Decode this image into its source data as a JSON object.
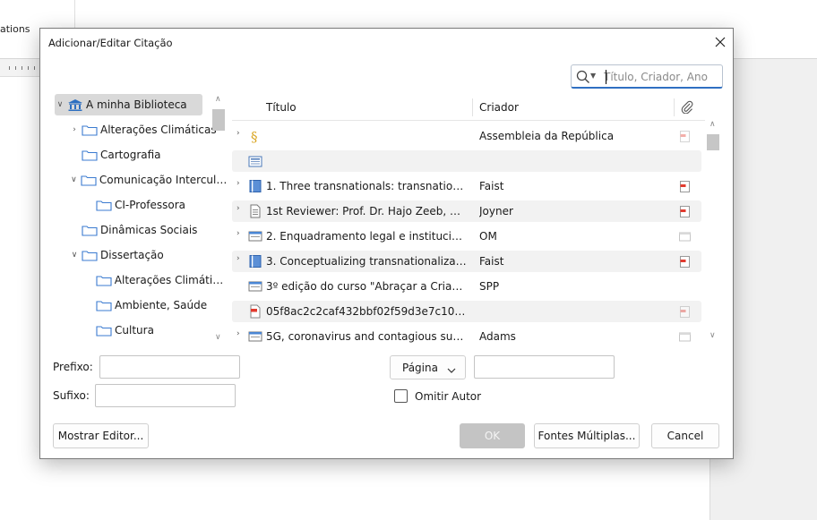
{
  "background": {
    "ribbon_text": "ations"
  },
  "dialog": {
    "title": "Adicionar/Editar Citação",
    "search": {
      "placeholder": "Título, Criador, Ano",
      "value": ""
    },
    "library": [
      {
        "label": "A minha Biblioteca",
        "icon": "library-icon",
        "twisty": "expanded",
        "selected": true
      },
      {
        "label": "Alterações Climáticas",
        "icon": "folder-icon",
        "twisty": "collapsed"
      },
      {
        "label": "Cartografia",
        "icon": "folder-icon",
        "twisty": "none"
      },
      {
        "label": "Comunicação Intercultural",
        "icon": "folder-icon",
        "twisty": "expanded"
      },
      {
        "label": "CI-Professora",
        "icon": "folder-icon",
        "twisty": "none"
      },
      {
        "label": "Dinâmicas Sociais",
        "icon": "folder-icon",
        "twisty": "none"
      },
      {
        "label": "Dissertação",
        "icon": "folder-icon",
        "twisty": "expanded"
      },
      {
        "label": "Alterações Climáticas",
        "icon": "folder-icon",
        "twisty": "none"
      },
      {
        "label": "Ambiente, Saúde",
        "icon": "folder-icon",
        "twisty": "none"
      },
      {
        "label": "Cultura",
        "icon": "folder-icon",
        "twisty": "none"
      }
    ],
    "table": {
      "columns": {
        "title": "Título",
        "creator": "Criador",
        "attachments_icon": "paperclip-icon"
      },
      "rows": [
        {
          "icon": "statute-icon",
          "title": "",
          "creator": "Assembleia da República",
          "twisty": true,
          "attachment": "pdf-faded"
        },
        {
          "icon": "newspaper-icon",
          "title": "",
          "creator": "",
          "twisty": false,
          "attachment": "none"
        },
        {
          "icon": "book-icon",
          "title": "1. Three transnationals: transnationalism and the...",
          "creator": "Faist",
          "twisty": true,
          "attachment": "pdf"
        },
        {
          "icon": "document-icon",
          "title": "1st Reviewer: Prof. Dr. Hajo Zeeb, Universität...",
          "creator": "Joyner",
          "twisty": true,
          "attachment": "pdf"
        },
        {
          "icon": "webpage-icon",
          "title": "2. Enquadramento legal e institucional...",
          "creator": "OM",
          "twisty": true,
          "attachment": "snapshot"
        },
        {
          "icon": "book-icon",
          "title": "3. Conceptualizing transnationalization...",
          "creator": "Faist",
          "twisty": true,
          "attachment": "pdf"
        },
        {
          "icon": "webpage-icon",
          "title": "3º edição do curso \"Abraçar a Criança\"...",
          "creator": "SPP",
          "twisty": false,
          "attachment": "none"
        },
        {
          "icon": "pdf-icon",
          "title": "05f8ac2c2caf432bbf02f59d3e7c10a0...",
          "creator": "",
          "twisty": false,
          "attachment": "pdf-faded"
        },
        {
          "icon": "webpage-icon",
          "title": "5G, coronavirus and contagious superspreading...",
          "creator": "Adams",
          "twisty": true,
          "attachment": "snapshot"
        }
      ]
    },
    "fields": {
      "prefix_label": "Prefixo:",
      "suffix_label": "Sufixo:",
      "prefix_value": "",
      "suffix_value": "",
      "locator_label": "Página",
      "locator_value": "",
      "omit_author_label": "Omitir Autor",
      "omit_author_checked": false
    },
    "buttons": {
      "show_editor": "Mostrar Editor...",
      "ok": "OK",
      "multiple_sources": "Fontes Múltiplas...",
      "cancel": "Cancel"
    }
  }
}
